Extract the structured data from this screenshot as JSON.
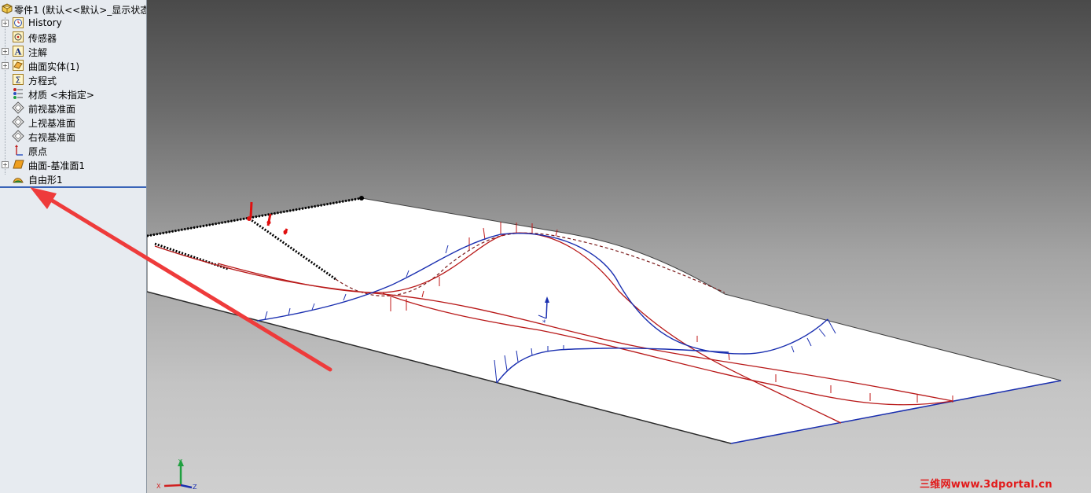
{
  "feature_tree": {
    "root_label": "零件1  (默认<<默认>_显示状态",
    "items": [
      {
        "label": "History",
        "icon": "history-icon",
        "expander": "+"
      },
      {
        "label": "传感器",
        "icon": "sensor-icon",
        "expander": ""
      },
      {
        "label": "注解",
        "icon": "annotation-icon",
        "expander": "+"
      },
      {
        "label": "曲面实体(1)",
        "icon": "surface-bodies-icon",
        "expander": "+"
      },
      {
        "label": "方程式",
        "icon": "equations-icon",
        "expander": ""
      },
      {
        "label": "材质 <未指定>",
        "icon": "material-icon",
        "expander": ""
      },
      {
        "label": "前视基准面",
        "icon": "plane-icon",
        "expander": ""
      },
      {
        "label": "上视基准面",
        "icon": "plane-icon",
        "expander": ""
      },
      {
        "label": "右视基准面",
        "icon": "plane-icon",
        "expander": ""
      },
      {
        "label": "原点",
        "icon": "origin-icon",
        "expander": ""
      },
      {
        "label": "曲面-基准面1",
        "icon": "planar-surface-icon",
        "expander": "+"
      },
      {
        "label": "自由形1",
        "icon": "freeform-icon",
        "expander": ""
      }
    ]
  },
  "triad": {
    "x_label": "X",
    "y_label": "Y",
    "z_label": "Z"
  },
  "watermark": "三维网www.3dportal.cn",
  "colors": {
    "annotation_arrow": "#ee3b3b",
    "curve_red": "#c01818",
    "curve_blue": "#1a2fb0",
    "rollback_bar": "#3a64b8",
    "surface_face": "#ffffff"
  }
}
